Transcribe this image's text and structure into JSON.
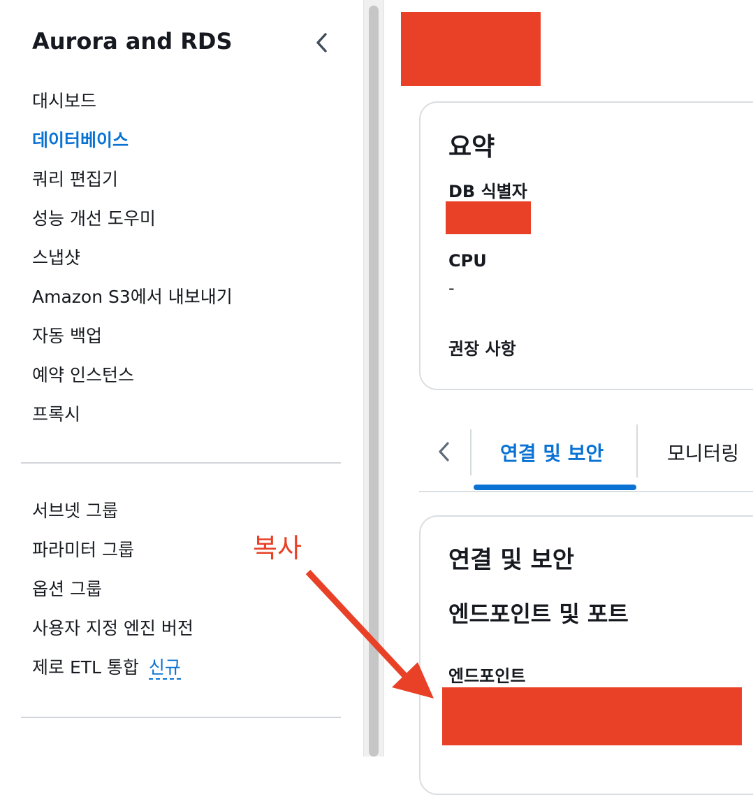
{
  "sidebar": {
    "title": "Aurora and RDS",
    "collapse_icon": "chevron-left-icon",
    "nav_primary": [
      {
        "label": "대시보드"
      },
      {
        "label": "데이터베이스",
        "active": true
      },
      {
        "label": "쿼리 편집기"
      },
      {
        "label": "성능 개선 도우미"
      },
      {
        "label": "스냅샷"
      },
      {
        "label": "Amazon S3에서 내보내기"
      },
      {
        "label": "자동 백업"
      },
      {
        "label": "예약 인스턴스"
      },
      {
        "label": "프록시"
      }
    ],
    "nav_secondary": [
      {
        "label": "서브넷 그룹"
      },
      {
        "label": "파라미터 그룹"
      },
      {
        "label": "옵션 그룹"
      },
      {
        "label": "사용자 지정 엔진 버전"
      },
      {
        "label": "제로 ETL 통합",
        "badge": "신규"
      }
    ]
  },
  "summary": {
    "title": "요약",
    "db_identifier_label": "DB 식별자",
    "cpu_label": "CPU",
    "cpu_value": "-",
    "recommendations_label": "권장 사항"
  },
  "tabs": {
    "prev_icon": "chevron-left-icon",
    "items": [
      {
        "label": "연결 및 보안",
        "active": true
      },
      {
        "label": "모니터링"
      }
    ]
  },
  "connectivity": {
    "title": "연결 및 보안",
    "section_title": "엔드포인트 및 포트",
    "endpoint_label": "엔드포인트"
  },
  "annotation": {
    "text": "복사",
    "color": "#e84127"
  },
  "colors": {
    "accent": "#0972d3",
    "redaction": "#e84127"
  }
}
